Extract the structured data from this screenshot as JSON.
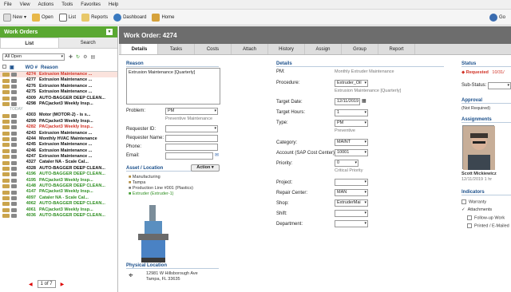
{
  "menu": [
    "File",
    "View",
    "Actions",
    "Tools",
    "Favorites",
    "Help"
  ],
  "toolbar": {
    "new": "New",
    "open": "Open",
    "list": "List",
    "reports": "Reports",
    "dashboard": "Dashboard",
    "home": "Home",
    "go": "Go"
  },
  "left": {
    "title": "Work Orders",
    "tabs": [
      "List",
      "Search"
    ],
    "filter": "All Open",
    "columns": {
      "wo": "WO #",
      "reason": "Reason"
    },
    "today_label": "TODAY",
    "rows": [
      {
        "wo": "4274",
        "reason": "Extrusion Maintenance ...",
        "color": "red"
      },
      {
        "wo": "4277",
        "reason": "Extrusion Maintenance ...",
        "color": "black"
      },
      {
        "wo": "4276",
        "reason": "Extrusion Maintenance ...",
        "color": "black"
      },
      {
        "wo": "4275",
        "reason": "Extrusion Maintenance ...",
        "color": "black"
      },
      {
        "wo": "4309",
        "reason": "AUTO-BAGGER DEEP CLEAN...",
        "color": "black"
      },
      {
        "wo": "4298",
        "reason": "PACjacket3 Weekly Insp...",
        "color": "black"
      },
      {
        "wo": "4303",
        "reason": "Motor (MOTOR-2) - is s...",
        "color": "black"
      },
      {
        "wo": "4299",
        "reason": "PACjacket3 Weekly Insp...",
        "color": "black"
      },
      {
        "wo": "4282",
        "reason": "PACjacket3 Weekly Insp...",
        "color": "red"
      },
      {
        "wo": "4243",
        "reason": "Extrusion Maintenance ...",
        "color": "black"
      },
      {
        "wo": "4244",
        "reason": "Monthly HVAC Maintenance",
        "color": "black"
      },
      {
        "wo": "4245",
        "reason": "Extrusion Maintenance ...",
        "color": "black"
      },
      {
        "wo": "4246",
        "reason": "Extrusion Maintenance ...",
        "color": "black"
      },
      {
        "wo": "4247",
        "reason": "Extrusion Maintenance ...",
        "color": "black"
      },
      {
        "wo": "4327",
        "reason": "Cataler NA - Scale Cal...",
        "color": "black"
      },
      {
        "wo": "4328",
        "reason": "AUTO-BAGGER DEEP CLEAN...",
        "color": "black"
      },
      {
        "wo": "4196",
        "reason": "AUTO-BAGGER DEEP CLEAN...",
        "color": "green"
      },
      {
        "wo": "4195",
        "reason": "PACjacket3 Weekly Insp...",
        "color": "green"
      },
      {
        "wo": "4148",
        "reason": "AUTO-BAGGER DEEP CLEAN...",
        "color": "green"
      },
      {
        "wo": "4147",
        "reason": "PACjacket3 Weekly Insp...",
        "color": "green"
      },
      {
        "wo": "4097",
        "reason": "Cataler NA - Scale Cal...",
        "color": "green"
      },
      {
        "wo": "4062",
        "reason": "AUTO-BAGGER DEEP CLEAN...",
        "color": "green"
      },
      {
        "wo": "4061",
        "reason": "PACjacket3 Weekly Insp...",
        "color": "green"
      },
      {
        "wo": "4036",
        "reason": "AUTO-BAGGER DEEP CLEAN...",
        "color": "green"
      }
    ],
    "pager": "1 of 7"
  },
  "main": {
    "title": "Work Order: 4274",
    "tabs": [
      "Details",
      "Tasks",
      "Costs",
      "Attach",
      "History",
      "Assign",
      "Group",
      "Report"
    ],
    "reason_label": "Reason",
    "reason_value": "Extrusion Maintenance [Quarterly]",
    "problem_label": "Problem:",
    "problem_value": "PM",
    "problem_desc": "Preventive Maintenance",
    "requester_id_label": "Requester ID:",
    "requester_name_label": "Requester Name:",
    "phone_label": "Phone:",
    "email_label": "Email:",
    "asset_label": "Asset / Location",
    "action_button": "Action",
    "asset_tree": [
      "Manufacturing",
      "Tampa",
      "Production Line #001 (Plastics)",
      "Extruder (Extruder-1)"
    ],
    "physical_label": "Physical Location",
    "address1": "12981 W Hillsborough Ave",
    "address2": "Tampa, FL 33635",
    "details_label": "Details",
    "pm_label": "PM:",
    "pm_value": "Monthly Extruder Maintenance",
    "procedure_label": "Procedure:",
    "procedure_value": "Extruder_Oil",
    "procedure_desc": "Extrusion Maintenance [Quarterly]",
    "target_date_label": "Target Date:",
    "target_date_value": "12/11/2019",
    "target_hours_label": "Target Hours:",
    "target_hours_value": "1",
    "type_label": "Type:",
    "type_value": "PM",
    "type_desc": "Preventive",
    "category_label": "Category:",
    "category_value": "MAINT",
    "account_label": "Account (SAP Cost Center):",
    "account_value": "10001",
    "priority_label": "Priority:",
    "priority_value": "0",
    "priority_desc": "Critical Priority",
    "project_label": "Project:",
    "repair_label": "Repair Center:",
    "repair_value": "MAN",
    "shop_label": "Shop:",
    "shop_value": "ExtruderMai",
    "shift_label": "Shift:",
    "department_label": "Department:",
    "status_label": "Status",
    "status_value": "Requested",
    "status_date": "10/31/",
    "substatus_label": "Sub-Status:",
    "approval_label": "Approval",
    "approval_value": "(Not Required)",
    "assignments_label": "Assignments",
    "assignee_name": "Scott Mickiewicz",
    "assignee_date": "12/11/2019 1 hr",
    "indicators_label": "Indicators",
    "indicators": [
      "Warranty",
      "Attachments",
      "Follow-up Work",
      "Printed / E-Mailed"
    ]
  }
}
